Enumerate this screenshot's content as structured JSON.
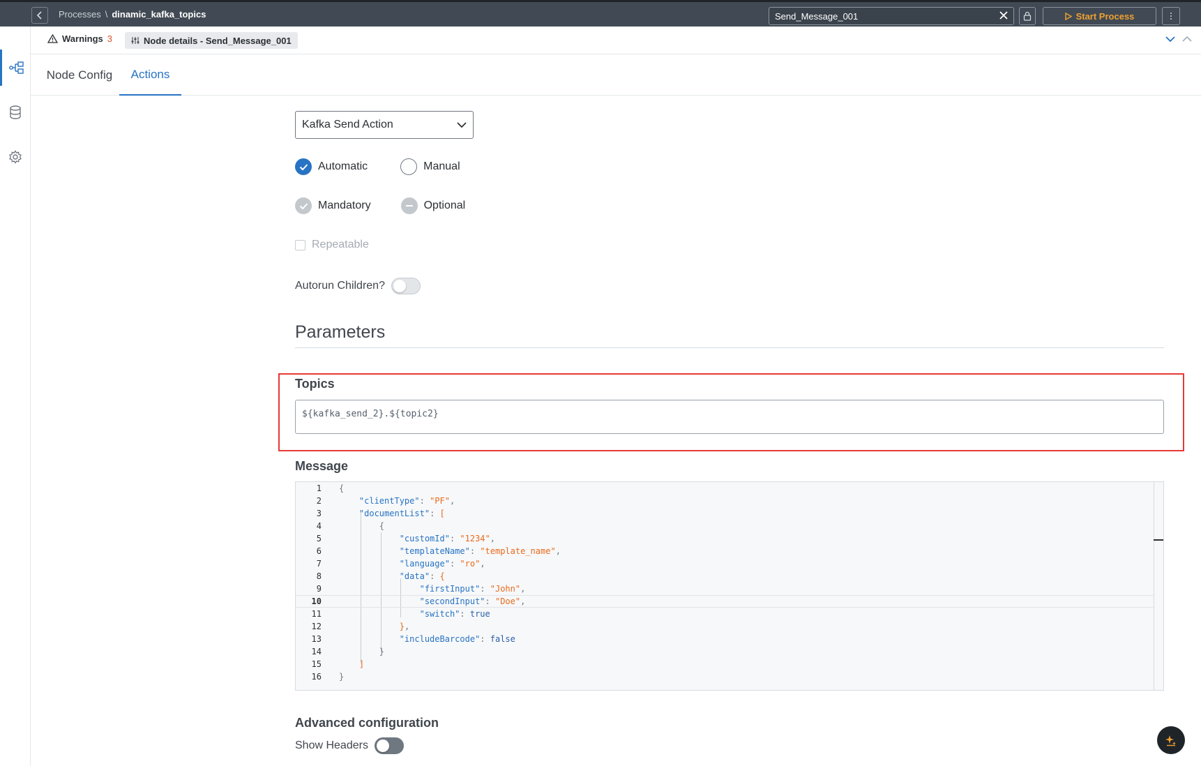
{
  "header": {
    "breadcrumb_root": "Processes",
    "breadcrumb_sep": "\\",
    "breadcrumb_current": "dinamic_kafka_topics",
    "search_value": "Send_Message_001",
    "start_label": "Start Process"
  },
  "subbar": {
    "warnings_label": "Warnings",
    "warnings_count": "3",
    "node_details_label": "Node details - Send_Message_001"
  },
  "tabs": [
    {
      "label": "Node Config"
    },
    {
      "label": "Actions"
    }
  ],
  "form": {
    "action_type": "Kafka Send Action",
    "radio_automatic": "Automatic",
    "radio_manual": "Manual",
    "radio_mandatory": "Mandatory",
    "radio_optional": "Optional",
    "repeatable_label": "Repeatable",
    "autorun_label": "Autorun Children?",
    "parameters_title": "Parameters",
    "topics_label": "Topics",
    "topics_value": "${kafka_send_2}.${topic2}",
    "message_label": "Message",
    "advanced_label": "Advanced configuration",
    "show_headers_label": "Show Headers"
  },
  "editor": {
    "active_line": 10,
    "lines": [
      "1",
      "2",
      "3",
      "4",
      "5",
      "6",
      "7",
      "8",
      "9",
      "10",
      "11",
      "12",
      "13",
      "14",
      "15",
      "16"
    ]
  },
  "colors": {
    "accent": "#2773c4",
    "warning": "#e0532b",
    "start": "#f0a030",
    "highlight": "#e53935"
  }
}
